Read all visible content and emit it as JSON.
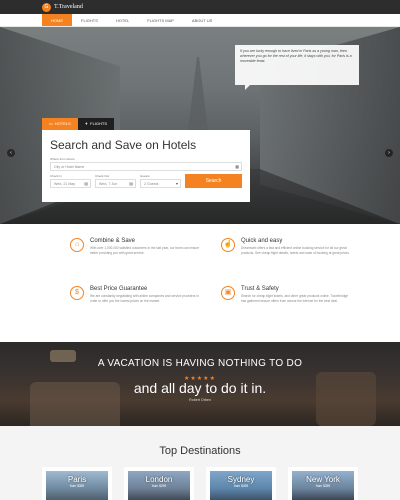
{
  "header": {
    "logo_mark": "G",
    "logo_text": "T.Traveland"
  },
  "nav": {
    "items": [
      "HOME",
      "FLIGHTS",
      "HOTEL",
      "FLIGHTS MAP",
      "ABOUT US"
    ],
    "active": 0
  },
  "hero": {
    "quote": "If you are lucky enough to have lived in Paris as a young man, then wherever you go for the rest of your life, it stays with you, for Paris is a moveable feast.",
    "tabs": [
      "HOTELS",
      "FLIGHTS"
    ],
    "panel_title": "Search and Save on Hotels",
    "where_label": "Where from where",
    "where_placeholder": "City or Hotel Name",
    "checkin_label": "Check In",
    "checkin_value": "Wed, 21 May",
    "checkout_label": "Check Out",
    "checkout_value": "Wed, 7 Jun",
    "guests_label": "Guests",
    "guests_value": "2 Guests",
    "search_button": "Search"
  },
  "features": [
    {
      "icon": "price-tag-icon",
      "title": "Combine & Save",
      "text": "With over 1,000,000 satisfied customers in the last year, our team can ensure better providing you with great service."
    },
    {
      "icon": "thumbs-up-icon",
      "title": "Quick and easy",
      "text": "Dreamweb offers a fast and efficient online booking service for all our great products. See cheap flight details, hotels and ease of booking at great prices."
    },
    {
      "icon": "dollar-icon",
      "title": "Best Price Guarantee",
      "text": "We are constantly negotiating with airline companies and service providers in order to offer you the lowest prices on the market."
    },
    {
      "icon": "lock-icon",
      "title": "Trust & Safety",
      "text": "Search for cheap flight tickets, and other great products online. Travelbridge has gathered secure offers from across the internet for the best deal."
    }
  ],
  "banner": {
    "title": "A VACATION IS HAVING NOTHING TO DO",
    "subtitle": "and all day to do it in.",
    "stars": "★★★★★",
    "author": "Robert Orben"
  },
  "destinations": {
    "title": "Top Destinations",
    "cards": [
      {
        "name": "Paris",
        "sub": "from $359"
      },
      {
        "name": "London",
        "sub": "from $299"
      },
      {
        "name": "Sydney",
        "sub": "from $499"
      },
      {
        "name": "New York",
        "sub": "from $359"
      }
    ]
  }
}
